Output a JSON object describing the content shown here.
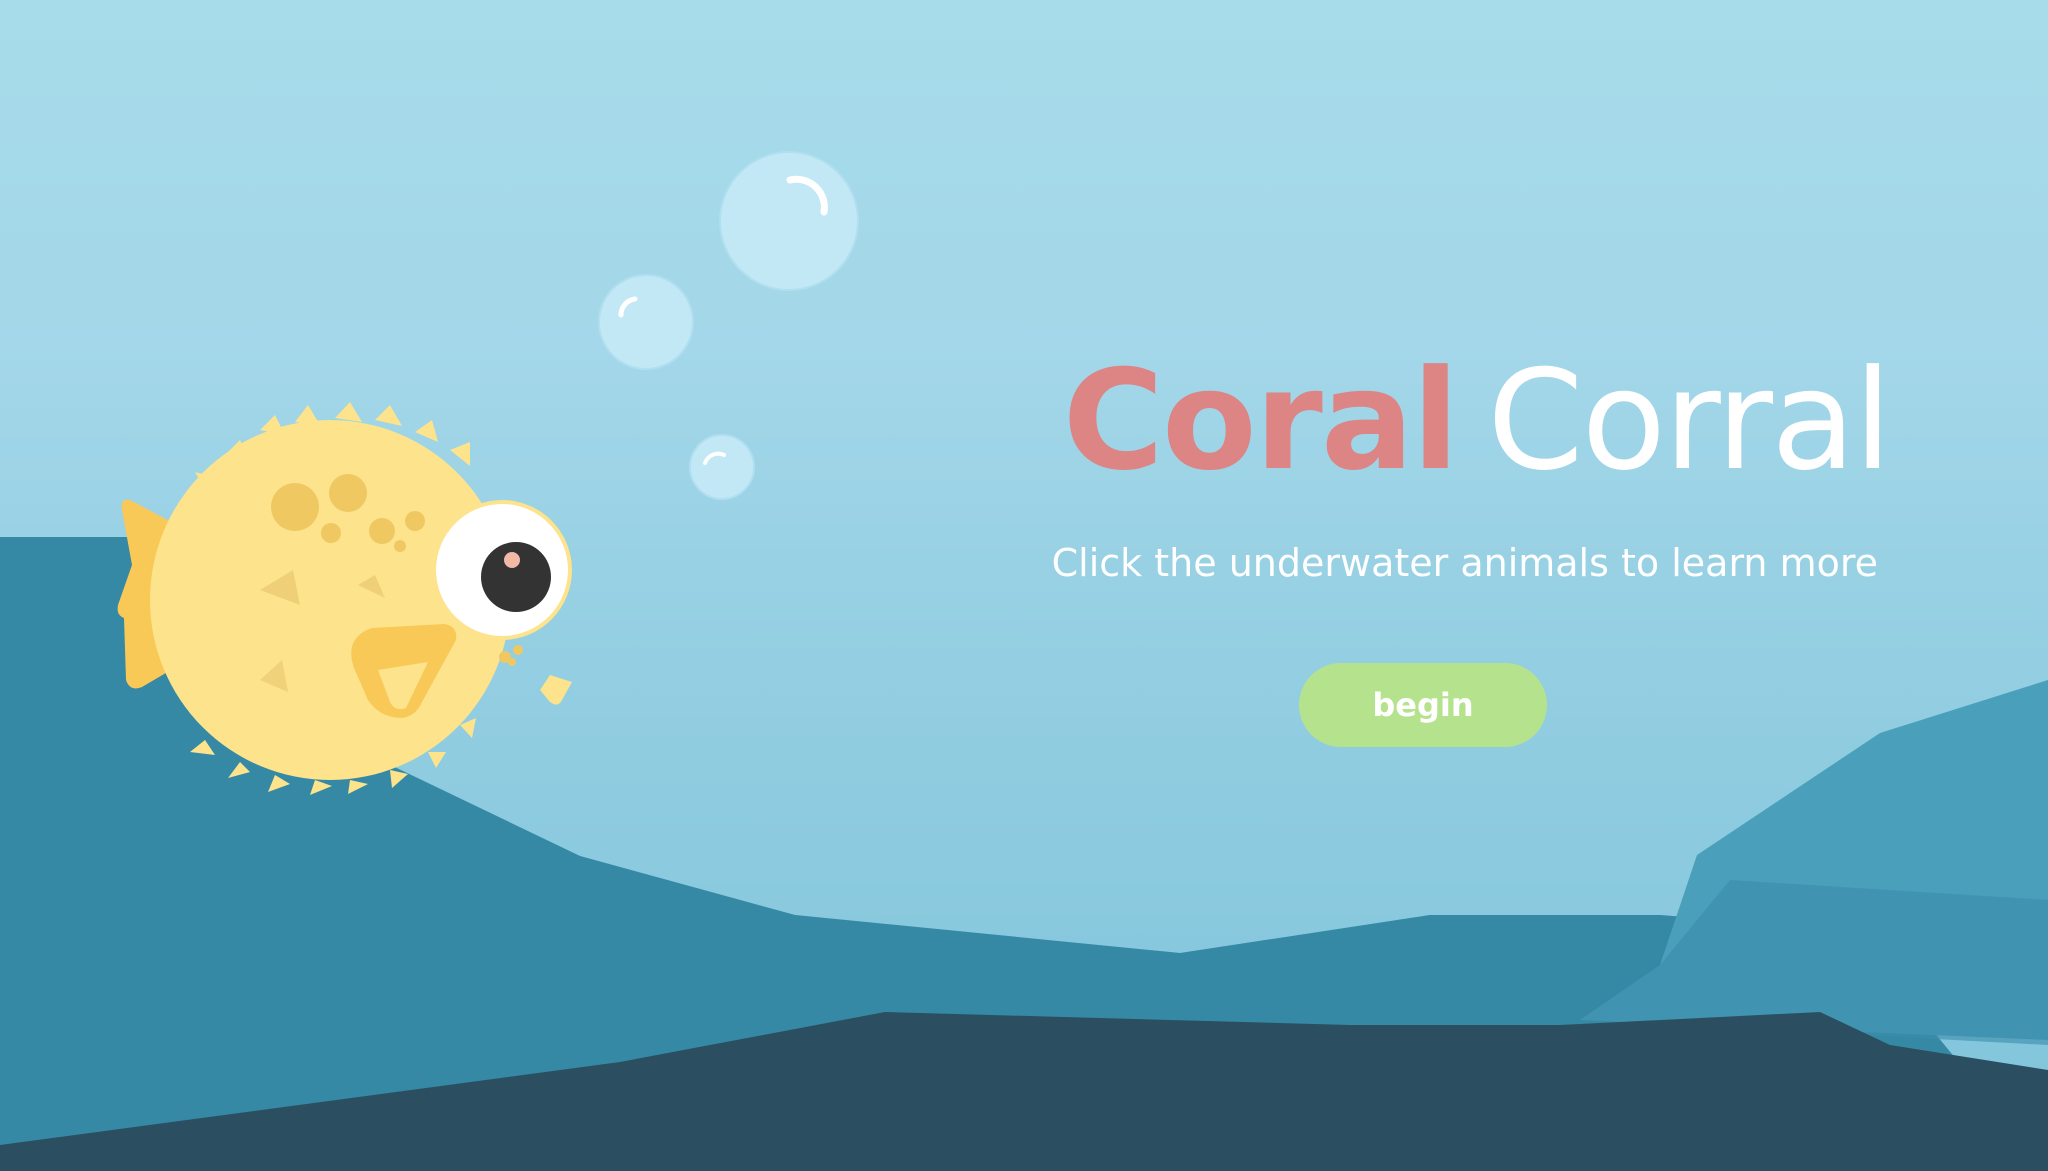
{
  "title": {
    "word1": "Coral",
    "word2": "Corral"
  },
  "subtitle": "Click the underwater animals to learn more",
  "begin_button": {
    "label": "begin"
  },
  "colors": {
    "water_top": "#a7dcea",
    "water_bottom": "#7fc4db",
    "title_accent": "#dd8484",
    "title_plain": "#ffffff",
    "button_bg": "#b5e38d",
    "button_text": "#ffffff",
    "seabed_dark": "#2b4f60",
    "seabed_mid": "#3a8fab",
    "fish_body": "#fce38c",
    "fish_fin": "#f8c957"
  },
  "icons": {
    "fish": "pufferfish",
    "bubbles": "bubble"
  }
}
